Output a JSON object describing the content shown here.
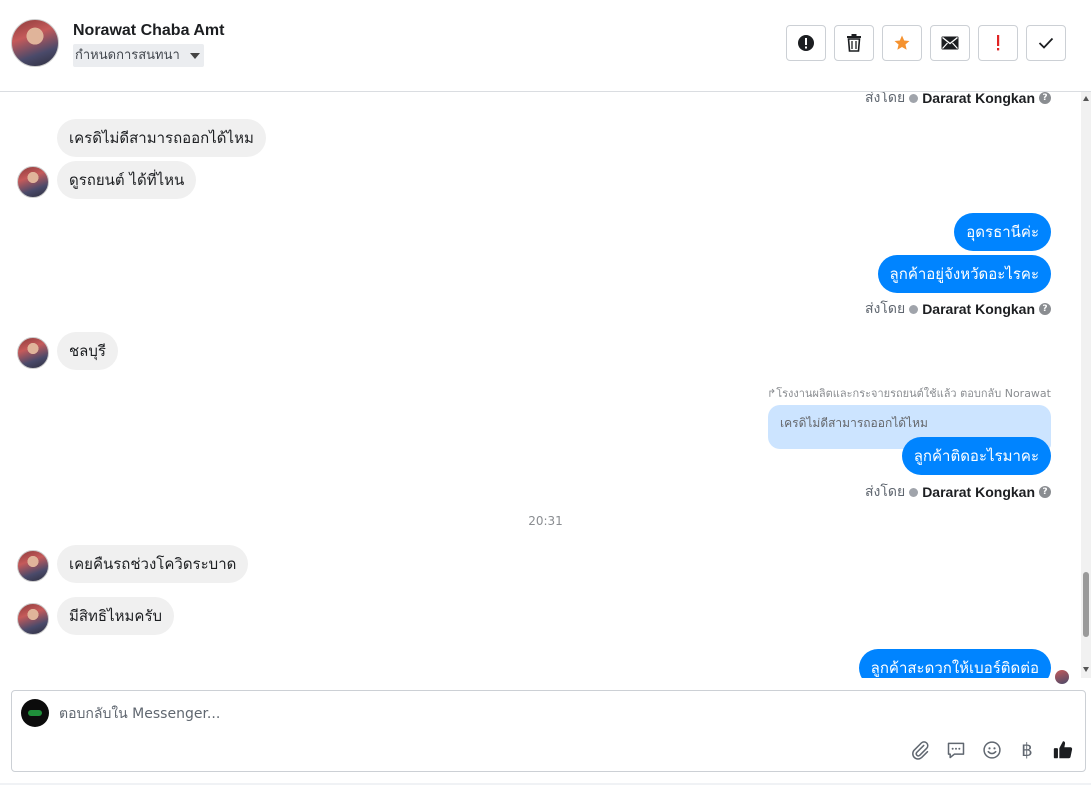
{
  "header": {
    "contact_name": "Norawat Chaba Amt",
    "label_dropdown": "กำหนดการสนทนา",
    "toolbar": [
      "spam",
      "delete",
      "star",
      "mark-unread",
      "follow-up",
      "done"
    ]
  },
  "messages": {
    "top_sentby_label": "ส่งโดย",
    "agent_name": "Dararat Kongkan",
    "in1": "เครดิไม่ดีสามารถออกได้ไหม",
    "in2": "ดูรถยนต์ ได้ที่ไหน",
    "out1": "อุดรธานีค่ะ",
    "out2": "ลูกค้าอยู่จังหวัดอะไรคะ",
    "sentby_label": "ส่งโดย",
    "in3": "ชลบุรี",
    "reply_meta": "↱โรงงานผลิตและกระจายรถยนต์ใช้แล้ว ตอบกลับ Norawat",
    "quoted_text": "เครดิไม่ดีสามารถออกได้ไหม",
    "out3": "ลูกค้าติดอะไรมาคะ",
    "timestamp": "20:31",
    "in4": "เคยคืนรถช่วงโควิดระบาด",
    "in5": "มีสิทธิไหมครับ",
    "out4": "ลูกค้าสะดวกให้เบอร์ติดต่อ"
  },
  "composer": {
    "placeholder": "ตอบกลับใน Messenger...",
    "icons": [
      "paperclip-icon",
      "saved-reply-icon",
      "emoji-icon",
      "baht-icon",
      "thumbs-up-icon"
    ],
    "baht_symbol": "฿"
  },
  "colors": {
    "outgoing_bubble": "#0084ff",
    "incoming_bubble": "#f0f0f0",
    "quote_bg": "#cce4ff",
    "star": "#f5922f",
    "followup": "#e02424"
  }
}
